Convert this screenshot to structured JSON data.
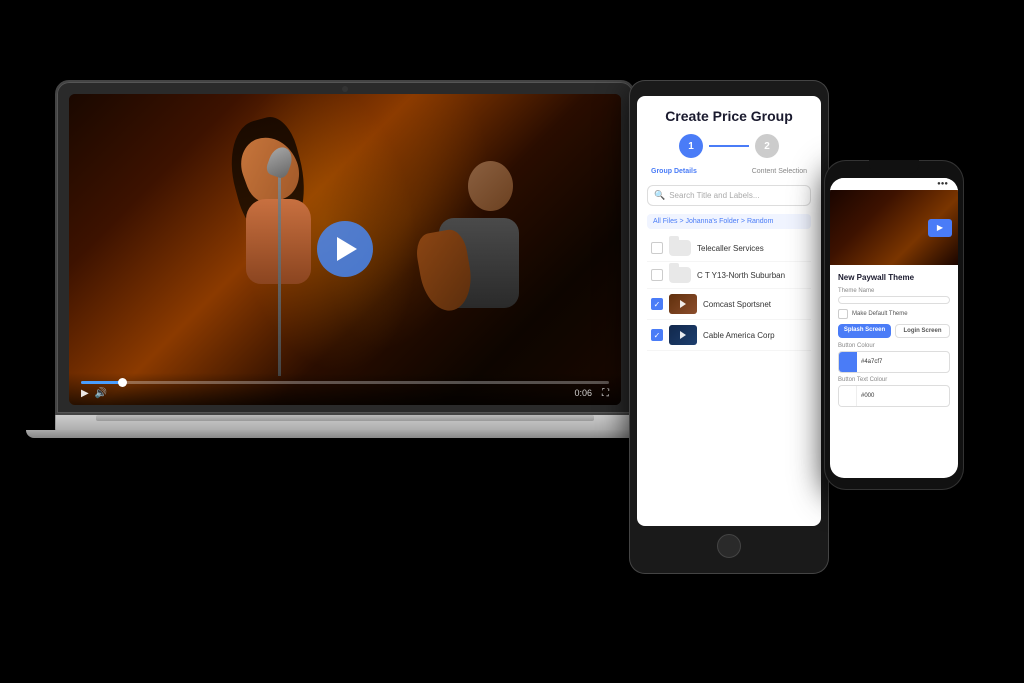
{
  "scene": {
    "bg_color": "#000000"
  },
  "laptop": {
    "video": {
      "play_button_visible": true,
      "time_current": "0:06",
      "progress_percent": 8,
      "concert_description": "Live band concert performance"
    }
  },
  "tablet": {
    "title": "Create Price Group",
    "steps": [
      {
        "number": "1",
        "label": "Group Details",
        "active": true
      },
      {
        "number": "2",
        "label": "Content Selection",
        "active": false
      }
    ],
    "search_placeholder": "Search Title and Labels...",
    "breadcrumb": "All Files > Johanna's Folder > Random",
    "files": [
      {
        "name": "Telecaller Services",
        "type": "folder",
        "checked": false
      },
      {
        "name": "C T Y13-North Suburban",
        "type": "folder",
        "checked": false
      },
      {
        "name": "Comcast Sportsnet",
        "type": "video",
        "checked": true
      },
      {
        "name": "Cable America Corp",
        "type": "video",
        "checked": true
      }
    ]
  },
  "phone": {
    "status_bar": {
      "time": "",
      "signal": "●●●",
      "battery": "■■■"
    },
    "video_thumb": "concert",
    "section_title": "New Paywall Theme",
    "fields": [
      {
        "label": "Theme Name",
        "value": "",
        "placeholder": ""
      },
      {
        "label": "Make Default Theme",
        "type": "checkbox"
      }
    ],
    "buttons": [
      {
        "label": "Splash Screen",
        "style": "blue"
      },
      {
        "label": "Login Screen",
        "style": "outline"
      }
    ],
    "color_fields": [
      {
        "label": "Button Colour",
        "color": "#4a7cf7",
        "value": "#4a7cf7"
      },
      {
        "label": "Button Text Colour",
        "color": "#000000",
        "value": "#000"
      }
    ]
  }
}
